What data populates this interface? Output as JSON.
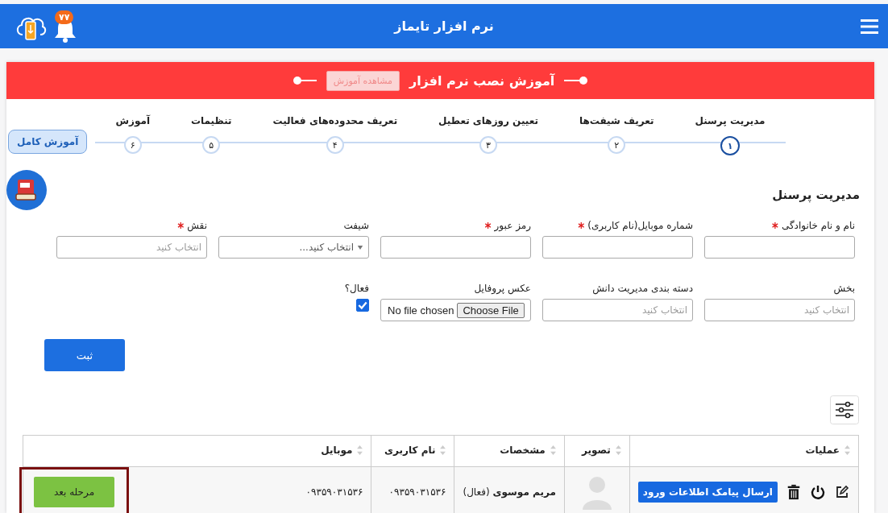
{
  "header": {
    "title": "نرم افزار تایماز",
    "notification_count": "۷۷"
  },
  "banner": {
    "title": "آموزش نصب نرم افزار",
    "button": "مشاهده آموزش"
  },
  "steps": [
    {
      "number": "۱",
      "label": "مدیریت پرسنل",
      "selected": true
    },
    {
      "number": "۲",
      "label": "تعریف شیفت‌ها",
      "selected": false
    },
    {
      "number": "۳",
      "label": "تعیین روزهای تعطیل",
      "selected": false
    },
    {
      "number": "۴",
      "label": "تعریف محدوده‌های فعالیت",
      "selected": false
    },
    {
      "number": "۵",
      "label": "تنظیمات",
      "selected": false
    },
    {
      "number": "۶",
      "label": "آموزش",
      "selected": false
    }
  ],
  "tutorial_bubble": "آموزش کامل",
  "section_title": "مدیریت پرسنل",
  "fields": [
    {
      "kind": "text",
      "label": "نام و نام خانوادگی",
      "required": true
    },
    {
      "kind": "text",
      "label": "شماره موبایل(نام کاربری)",
      "required": true
    },
    {
      "kind": "text",
      "label": "رمز عبور",
      "required": true
    },
    {
      "kind": "select",
      "label": "شیفت",
      "required": false,
      "placeholder": "انتخاب کنید..."
    },
    {
      "kind": "picker",
      "label": "نقش",
      "required": true,
      "placeholder": "انتخاب کنید"
    },
    {
      "kind": "picker",
      "label": "بخش",
      "required": false,
      "placeholder": "انتخاب کنید"
    },
    {
      "kind": "picker",
      "label": "دسته بندی مدیریت دانش",
      "required": false,
      "placeholder": "انتخاب کنید"
    },
    {
      "kind": "file",
      "label": "عکس پروفایل",
      "required": false,
      "button": "Choose File",
      "status": "No file chosen"
    },
    {
      "kind": "checkbox",
      "label": "فعال؟",
      "required": false,
      "checked": true
    }
  ],
  "submit_button": "ثبت",
  "table": {
    "columns": [
      "عملیات",
      "تصویر",
      "مشخصات",
      "نام کاربری",
      "موبایل"
    ],
    "rows": [
      {
        "sms_button": "ارسال پیامک اطلاعات ورود",
        "details": "**مریم موسوی** (فعال)",
        "username": "۰۹۳۵۹۰۳۱۵۳۶",
        "mobile": "۰۹۳۵۹۰۳۱۵۳۶"
      }
    ]
  },
  "next_button": "مرحله بعد"
}
